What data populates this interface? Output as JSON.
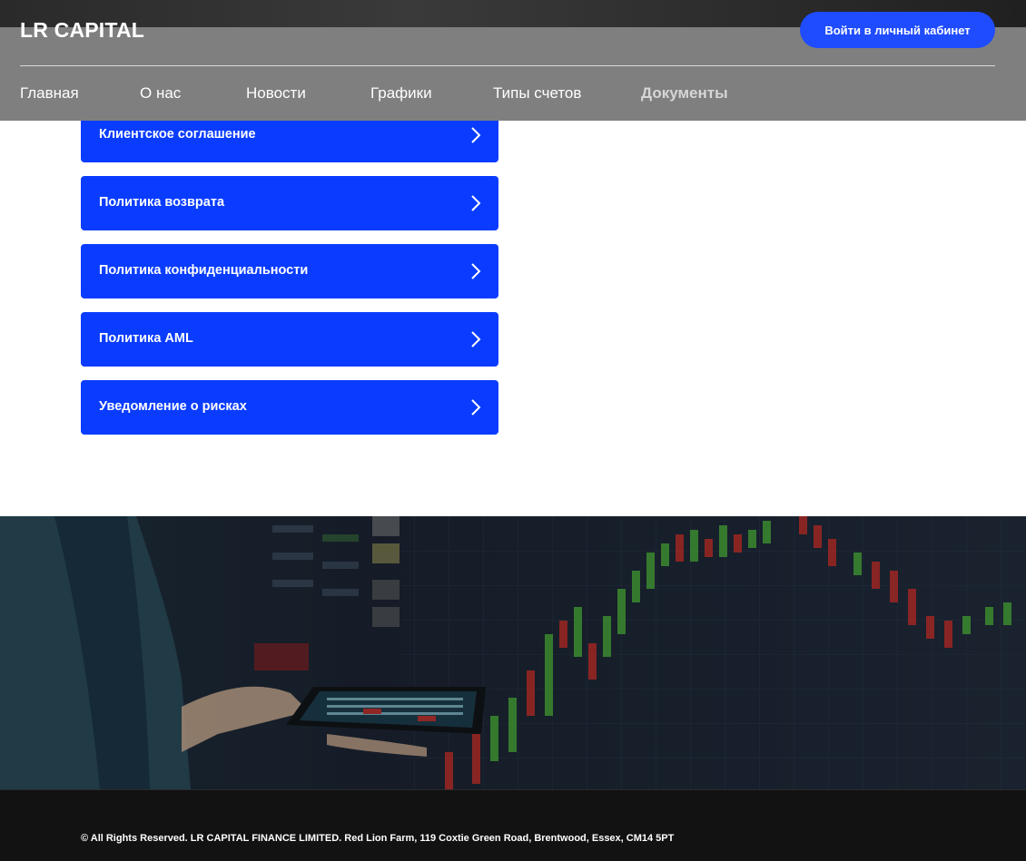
{
  "header": {
    "logo": "LR CAPITAL",
    "login_button": "Войти в личный кабинет",
    "nav": [
      {
        "label": "Главная",
        "active": false
      },
      {
        "label": "О нас",
        "active": false
      },
      {
        "label": "Новости",
        "active": false
      },
      {
        "label": "Графики",
        "active": false
      },
      {
        "label": "Типы счетов",
        "active": false
      },
      {
        "label": "Документы",
        "active": true
      }
    ]
  },
  "documents": [
    {
      "label": "Клиентское соглашение",
      "icon": "chevron-right-icon"
    },
    {
      "label": "Политика возврата",
      "icon": "chevron-right-icon"
    },
    {
      "label": "Политика конфиденциальности",
      "icon": "chevron-right-icon"
    },
    {
      "label": "Политика AML",
      "icon": "chevron-right-icon"
    },
    {
      "label": "Уведомление о рисках",
      "icon": "chevron-right-icon"
    }
  ],
  "footer": {
    "copyright": "© All Rights Reserved. LR CAPITAL FINANCE LIMITED. Red Lion Farm, 119 Coxtie Green Road, Brentwood, Essex, CM14 5PT"
  },
  "colors": {
    "header_bg": "#7f7f7f",
    "accent": "#1f4cff",
    "doc_button": "#0a3cff",
    "footer_bg": "#121212"
  }
}
